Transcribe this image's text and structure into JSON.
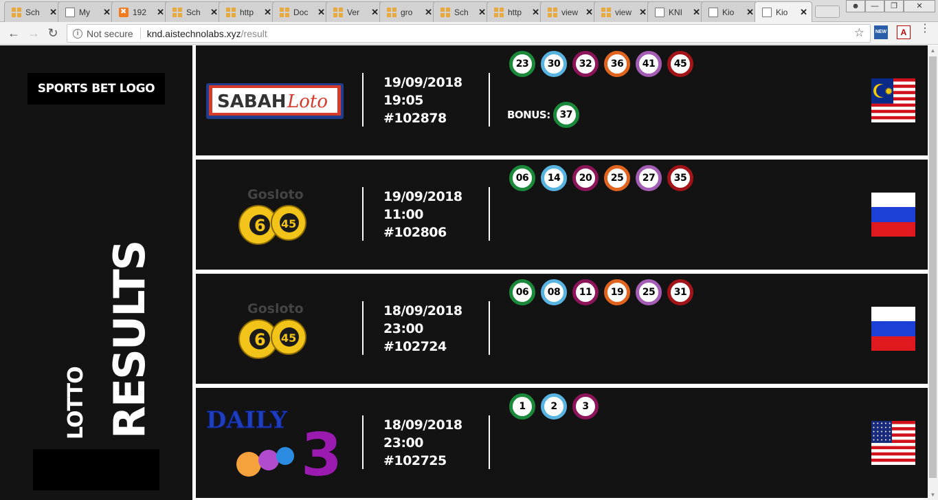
{
  "browser": {
    "tabs": [
      {
        "title": "Sch",
        "icon": "grid-icon"
      },
      {
        "title": "My",
        "icon": "document-icon"
      },
      {
        "title": "192",
        "icon": "xampp-icon"
      },
      {
        "title": "Sch",
        "icon": "grid-icon"
      },
      {
        "title": "http",
        "icon": "grid-icon"
      },
      {
        "title": "Doc",
        "icon": "grid-icon"
      },
      {
        "title": "Ver",
        "icon": "grid-icon"
      },
      {
        "title": "gro",
        "icon": "grid-icon"
      },
      {
        "title": "Sch",
        "icon": "grid-icon"
      },
      {
        "title": "http",
        "icon": "grid-icon"
      },
      {
        "title": "view",
        "icon": "grid-icon"
      },
      {
        "title": "view",
        "icon": "grid-icon"
      },
      {
        "title": "KNI",
        "icon": "document-icon"
      },
      {
        "title": "Kio",
        "icon": "document-icon"
      },
      {
        "title": "Kio",
        "icon": "document-icon",
        "active": true
      }
    ],
    "address": {
      "security": "Not secure",
      "host": "knd.aistechnolabs.xyz",
      "path": "/result"
    },
    "extensions": {
      "news": "NEW",
      "pdf": "A"
    }
  },
  "sidebar": {
    "logo_text": "SPORTS BET LOGO",
    "lotto_label": "LOTTO",
    "results_label": "RESULTS"
  },
  "results": [
    {
      "lottery": "SABAHLoto",
      "logo_text": {
        "main": "SABAH",
        "accent": "Loto"
      },
      "date": "19/09/2018",
      "time": "19:05",
      "draw": "#102878",
      "balls": [
        "23",
        "30",
        "32",
        "36",
        "41",
        "45"
      ],
      "bonus_label": "BONUS:",
      "bonus": "37",
      "flag": "malaysia-flag"
    },
    {
      "lottery": "Gosloto 6/45",
      "logo_text": {
        "main": "Gosloto",
        "n1": "6",
        "n2": "45"
      },
      "date": "19/09/2018",
      "time": "11:00",
      "draw": "#102806",
      "balls": [
        "06",
        "14",
        "20",
        "25",
        "27",
        "35"
      ],
      "flag": "russia-flag"
    },
    {
      "lottery": "Gosloto 6/45",
      "logo_text": {
        "main": "Gosloto",
        "n1": "6",
        "n2": "45"
      },
      "date": "18/09/2018",
      "time": "23:00",
      "draw": "#102724",
      "balls": [
        "06",
        "08",
        "11",
        "19",
        "25",
        "31"
      ],
      "flag": "russia-flag"
    },
    {
      "lottery": "Daily 3",
      "logo_text": {
        "main": "DAILY",
        "num": "3"
      },
      "date": "18/09/2018",
      "time": "23:00",
      "draw": "#102725",
      "balls": [
        "1",
        "2",
        "3"
      ],
      "flag": "usa-flag"
    }
  ],
  "colors": {
    "background": "#131313",
    "ball_borders": [
      "#1a8a3a",
      "#58b3e0",
      "#8c1458",
      "#e0641e",
      "#a45db4",
      "#a31419"
    ]
  }
}
